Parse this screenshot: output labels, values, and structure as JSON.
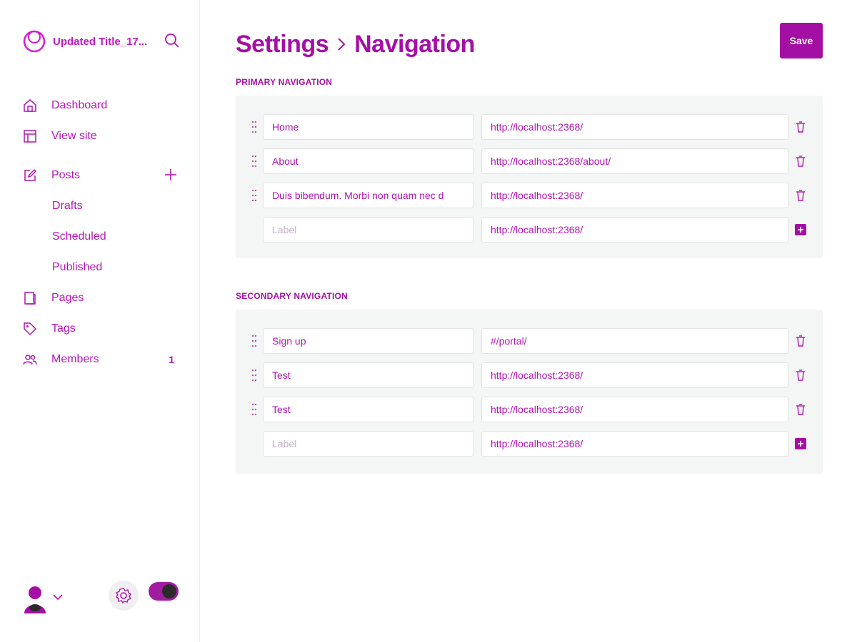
{
  "sidebar": {
    "brand_title": "Updated Title_17...",
    "brand_logo_icon": "ghost-logo-icon",
    "search_icon": "search-icon",
    "items": [
      {
        "label": "Dashboard",
        "icon": "home-icon"
      },
      {
        "label": "View site",
        "icon": "browser-icon"
      },
      {
        "label": "Posts",
        "icon": "edit-icon",
        "action_icon": "plus-icon"
      },
      {
        "label": "Drafts"
      },
      {
        "label": "Scheduled"
      },
      {
        "label": "Published"
      },
      {
        "label": "Pages",
        "icon": "page-icon"
      },
      {
        "label": "Tags",
        "icon": "tag-icon"
      },
      {
        "label": "Members",
        "icon": "members-icon",
        "count": "1"
      }
    ],
    "footer": {
      "avatar_icon": "user-avatar-icon",
      "chevron_icon": "chevron-down-icon",
      "settings_icon": "gear-icon",
      "theme_toggle_icon": "dark-mode-toggle-icon"
    }
  },
  "header": {
    "breadcrumb_parent": "Settings",
    "breadcrumb_current": "Navigation",
    "save_label": "Save"
  },
  "primary": {
    "title": "PRIMARY NAVIGATION",
    "rows": [
      {
        "label": "Home",
        "url": "http://localhost:2368/"
      },
      {
        "label": "About",
        "url": "http://localhost:2368/about/"
      },
      {
        "label": "Duis bibendum. Morbi non quam nec d",
        "url": "http://localhost:2368/"
      }
    ],
    "new_row": {
      "label_placeholder": "Label",
      "url": "http://localhost:2368/"
    }
  },
  "secondary": {
    "title": "SECONDARY NAVIGATION",
    "rows": [
      {
        "label": "Sign up",
        "url": "#/portal/"
      },
      {
        "label": "Test",
        "url": "http://localhost:2368/"
      },
      {
        "label": "Test",
        "url": "http://localhost:2368/"
      }
    ],
    "new_row": {
      "label_placeholder": "Label",
      "url": "http://localhost:2368/"
    }
  },
  "colors": {
    "accent": "#a30fa3",
    "text": "#b015b0",
    "section_bg": "#f4f5f5"
  }
}
